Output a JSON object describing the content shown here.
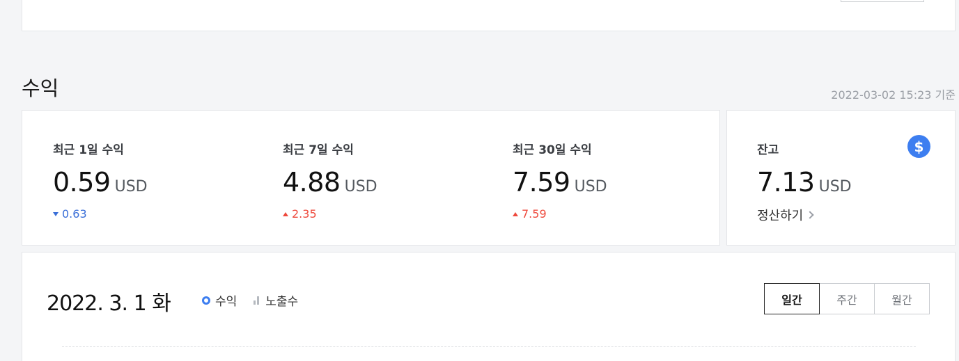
{
  "section": {
    "title": "수익",
    "timestamp": "2022-03-02 15:23 기준"
  },
  "revenue": [
    {
      "label": "최근 1일 수익",
      "value": "0.59",
      "unit": "USD",
      "change": "0.63",
      "direction": "down"
    },
    {
      "label": "최근 7일 수익",
      "value": "4.88",
      "unit": "USD",
      "change": "2.35",
      "direction": "up"
    },
    {
      "label": "최근 30일 수익",
      "value": "7.59",
      "unit": "USD",
      "change": "7.59",
      "direction": "up"
    }
  ],
  "balance": {
    "label": "잔고",
    "value": "7.13",
    "unit": "USD",
    "icon": "dollar-icon",
    "icon_symbol": "$",
    "settle_label": "정산하기"
  },
  "chart_panel": {
    "date": "2022. 3. 1 화",
    "legend": [
      {
        "label": "수익",
        "icon": "circle-icon"
      },
      {
        "label": "노출수",
        "icon": "bar-chart-icon"
      }
    ],
    "tabs": [
      {
        "label": "일간",
        "active": true
      },
      {
        "label": "주간",
        "active": false
      },
      {
        "label": "월간",
        "active": false
      }
    ]
  },
  "colors": {
    "accent": "#3d7ef0",
    "down": "#3a6fd8",
    "up": "#ee4a3d"
  }
}
